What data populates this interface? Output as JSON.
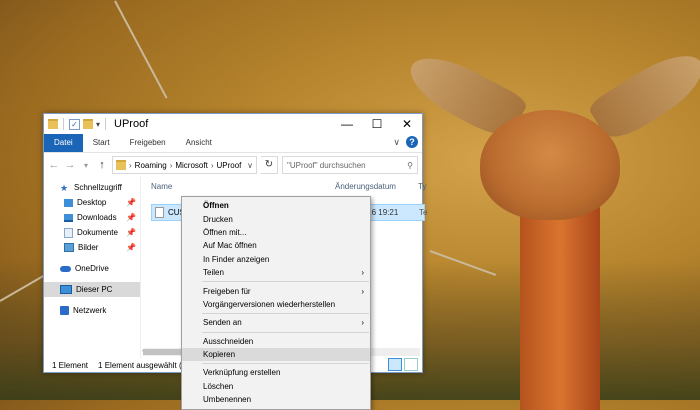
{
  "window": {
    "title": "UProof",
    "controls": {
      "minimize": "—",
      "maximize": "☐",
      "close": "✕"
    }
  },
  "ribbon": {
    "tabs": [
      "Datei",
      "Start",
      "Freigeben",
      "Ansicht"
    ],
    "help": "?"
  },
  "address": {
    "path": [
      "Roaming",
      "Microsoft",
      "UProof"
    ],
    "search_placeholder": "\"UProof\" durchsuchen"
  },
  "nav": {
    "quick_access": "Schnellzugriff",
    "quick_items": [
      "Desktop",
      "Downloads",
      "Dokumente",
      "Bilder"
    ],
    "onedrive": "OneDrive",
    "this_pc": "Dieser PC",
    "network": "Netzwerk"
  },
  "columns": {
    "name": "Name",
    "date": "Änderungsdatum",
    "type": "Ty"
  },
  "files": [
    {
      "name": "CUSTOM",
      "date": "26.05.2016 19:21",
      "type": "Te"
    }
  ],
  "status": {
    "count": "1 Element",
    "selected": "1 Element ausgewählt (2 E"
  },
  "context_menu": {
    "groups": [
      [
        {
          "label": "Öffnen",
          "bold": true
        },
        {
          "label": "Drucken"
        },
        {
          "label": "Öffnen mit..."
        },
        {
          "label": "Auf Mac öffnen"
        },
        {
          "label": "In Finder anzeigen"
        },
        {
          "label": "Teilen",
          "submenu": true
        }
      ],
      [
        {
          "label": "Freigeben für",
          "submenu": true
        },
        {
          "label": "Vorgängerversionen wiederherstellen"
        }
      ],
      [
        {
          "label": "Senden an",
          "submenu": true
        }
      ],
      [
        {
          "label": "Ausschneiden"
        },
        {
          "label": "Kopieren",
          "hover": true
        }
      ],
      [
        {
          "label": "Verknüpfung erstellen"
        },
        {
          "label": "Löschen"
        },
        {
          "label": "Umbenennen"
        }
      ]
    ]
  }
}
